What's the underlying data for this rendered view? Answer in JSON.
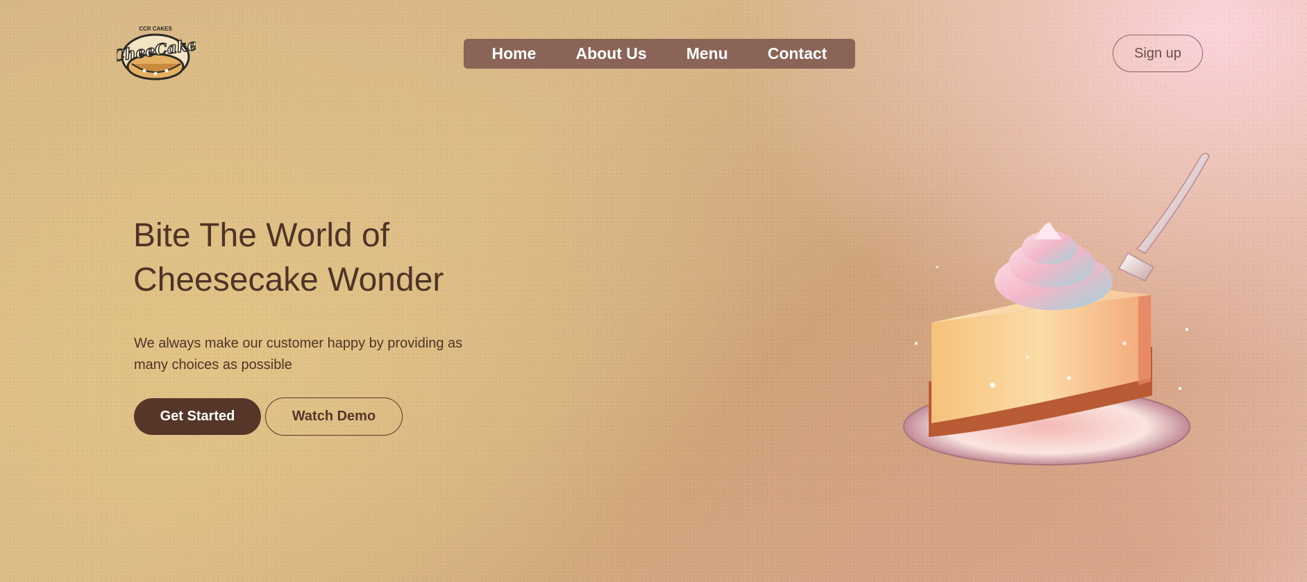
{
  "brand": {
    "logo_name": "CheeseCake",
    "logo_text": "CheeCake",
    "logo_tagline": "CCR CAKES"
  },
  "nav": {
    "items": [
      {
        "label": "Home"
      },
      {
        "label": "About Us"
      },
      {
        "label": "Menu"
      },
      {
        "label": "Contact"
      }
    ],
    "signup_label": "Sign up"
  },
  "hero": {
    "title_line1": "Bite The World of",
    "title_line2": "Cheesecake Wonder",
    "subtitle_line1": "We always make our customer happy by providing as",
    "subtitle_line2": "many choices as possible",
    "primary_cta": "Get Started",
    "secondary_cta": "Watch Demo"
  },
  "colors": {
    "nav_bg": "#8a6457",
    "primary_button": "#553628",
    "text_dark": "#4e3426"
  }
}
